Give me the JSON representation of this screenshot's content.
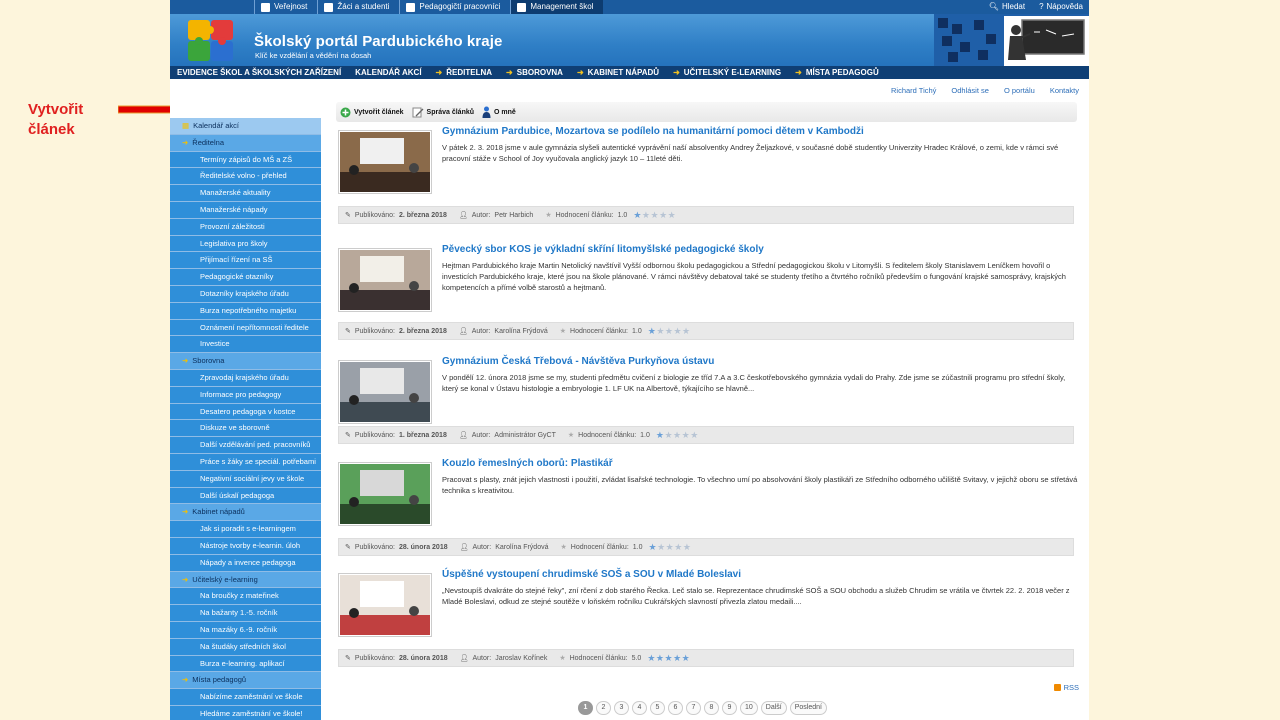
{
  "annotation": {
    "text_line1": "Vytvořit",
    "text_line2": "článek"
  },
  "topbar": {
    "tabs": [
      {
        "label": "Veřejnost",
        "active": false
      },
      {
        "label": "Žáci a studenti",
        "active": false
      },
      {
        "label": "Pedagogičtí pracovníci",
        "active": false
      },
      {
        "label": "Management škol",
        "active": true
      }
    ],
    "search_label": "Hledat",
    "help_label": "Nápověda"
  },
  "banner": {
    "title": "Školský portál Pardubického kraje",
    "subtitle": "Klíč ke vzdělání a vědění na dosah"
  },
  "mainnav": [
    {
      "label": "EVIDENCE ŠKOL A ŠKOLSKÝCH ZAŘÍZENÍ",
      "arrow": false
    },
    {
      "label": "KALENDÁŘ AKCÍ",
      "arrow": false
    },
    {
      "label": "ŘEDITELNA",
      "arrow": true
    },
    {
      "label": "SBOROVNA",
      "arrow": true
    },
    {
      "label": "KABINET NÁPADŮ",
      "arrow": true
    },
    {
      "label": "UČITELSKÝ E-LEARNING",
      "arrow": true
    },
    {
      "label": "MÍSTA PEDAGOGŮ",
      "arrow": true
    }
  ],
  "userbar": {
    "user": "Richard Tichý",
    "logout": "Odhlásit se",
    "about": "O portálu",
    "contacts": "Kontakty"
  },
  "toolbar": {
    "create": "Vytvořit článek",
    "manage": "Správa článků",
    "about_me": "O mně"
  },
  "sidebar": [
    {
      "label": "Kalendář akcí",
      "cat": true,
      "first": true
    },
    {
      "label": "Ředitelna",
      "cat": true
    },
    {
      "label": "Termíny zápisů do MŠ a ZŠ"
    },
    {
      "label": "Ředitelské volno - přehled"
    },
    {
      "label": "Manažerské aktuality"
    },
    {
      "label": "Manažerské nápady"
    },
    {
      "label": "Provozní záležitosti"
    },
    {
      "label": "Legislativa pro školy"
    },
    {
      "label": "Přijímací řízení na SŠ"
    },
    {
      "label": "Pedagogické otazníky"
    },
    {
      "label": "Dotazníky krajského úřadu"
    },
    {
      "label": "Burza nepotřebného majetku"
    },
    {
      "label": "Oznámení nepřítomnosti ředitele"
    },
    {
      "label": "Investice"
    },
    {
      "label": "Sborovna",
      "cat": true
    },
    {
      "label": "Zpravodaj krajského úřadu"
    },
    {
      "label": "Informace pro pedagogy"
    },
    {
      "label": "Desatero pedagoga v kostce"
    },
    {
      "label": "Diskuze ve sborovně"
    },
    {
      "label": "Další vzdělávání ped. pracovníků"
    },
    {
      "label": "Práce s žáky se speciál. potřebami"
    },
    {
      "label": "Negativní sociální jevy ve škole"
    },
    {
      "label": "Další úskalí pedagoga"
    },
    {
      "label": "Kabinet nápadů",
      "cat": true
    },
    {
      "label": "Jak si poradit s e-learningem"
    },
    {
      "label": "Nástroje tvorby e-learnin. úloh"
    },
    {
      "label": "Nápady a invence pedagoga"
    },
    {
      "label": "Učitelský e-learning",
      "cat": true
    },
    {
      "label": "Na broučky z mateřinek"
    },
    {
      "label": "Na bažanty 1.-5. ročník"
    },
    {
      "label": "Na mazáky 6.-9. ročník"
    },
    {
      "label": "Na študáky středních škol"
    },
    {
      "label": "Burza e-learning. aplikací"
    },
    {
      "label": "Místa pedagogů",
      "cat": true
    },
    {
      "label": "Nabízíme zaměstnání ve škole"
    },
    {
      "label": "Hledáme zaměstnání ve škole!"
    }
  ],
  "meta_labels": {
    "published": "Publikováno:",
    "author": "Autor:",
    "rating": "Hodnocení článku:"
  },
  "articles": [
    {
      "title": "Gymnázium Pardubice, Mozartova se podílelo na humanitární pomoci dětem v Kambodži",
      "text": "V pátek 2. 3. 2018 jsme v aule gymnázia slyšeli autentické vyprávění naší absolventky Andrey Željazkové, v současné době studentky Univerzity Hradec Králové, o zemi, kde v rámci své pracovní stáže v School of Joy vyučovala anglický jazyk 10 – 11leté děti.",
      "date": "2. března 2018",
      "author": "Petr Harbich",
      "rating": "1.0",
      "stars_on": 1
    },
    {
      "title": "Pěvecký sbor KOS je výkladní skříní litomyšlské pedagogické školy",
      "text": "Hejtman Pardubického kraje Martin Netolický navštívil Vyšší odbornou školu pedagogickou a Střední pedagogickou školu v Litomyšli. S ředitelem školy Stanislavem Leníčkem hovořil o investicích Pardubického kraje, které jsou na škole plánované. V rámci návštěvy debatoval také se studenty třetího a čtvrtého ročníků především o fungování krajské samosprávy, krajských kompetencích a přímé volbě starostů a hejtmanů.",
      "date": "2. března 2018",
      "author": "Karolína Frýdová",
      "rating": "1.0",
      "stars_on": 1
    },
    {
      "title": "Gymnázium Česká Třebová - Návštěva Purkyňova ústavu",
      "text": "V pondělí 12. února 2018 jsme se my, studenti předmětu cvičení z biologie ze tříd 7.A a 3.C českotřebovského gymnázia vydali do Prahy. Zde jsme se zúčastnili programu pro střední školy, který se konal v Ústavu histologie a embryologie 1. LF UK na Albertově, týkajícího se hlavně...",
      "date": "1. března 2018",
      "author": "Administrátor GyCT",
      "rating": "1.0",
      "stars_on": 1
    },
    {
      "title": "Kouzlo řemeslných oborů: Plastikář",
      "text": "Pracovat s plasty, znát jejich vlastnosti i použití, zvládat lisařské technologie. To všechno umí po absolvování školy plastikáři ze Středního odborného učiliště Svitavy, v jejichž oboru se střetává technika s kreativitou.",
      "date": "28. února 2018",
      "author": "Karolína Frýdová",
      "rating": "1.0",
      "stars_on": 1
    },
    {
      "title": "Úspěšné vystoupení chrudimské SOŠ a SOU v Mladé Boleslavi",
      "text": "„Nevstoupíš dvakráte do stejné řeky\", zní rčení z dob starého Řecka. Leč stalo se. Reprezentace chrudimské SOŠ a SOU obchodu a služeb Chrudim se vrátila ve čtvrtek 22. 2. 2018 večer z Mladé Boleslavi, odkud ze stejné soutěže v loňském ročníku Cukrářských slavností přivezla zlatou medaili....",
      "date": "28. února 2018",
      "author": "Jaroslav Kořínek",
      "rating": "5.0",
      "stars_on": 5
    }
  ],
  "rss": "RSS",
  "pager": [
    "1",
    "2",
    "3",
    "4",
    "5",
    "6",
    "7",
    "8",
    "9",
    "10",
    "Další",
    "Poslední"
  ],
  "colors": {
    "accent": "#2078c8",
    "nav": "#0f3f75",
    "sidebar": "#2f8fd9",
    "annotation": "#e02020"
  }
}
